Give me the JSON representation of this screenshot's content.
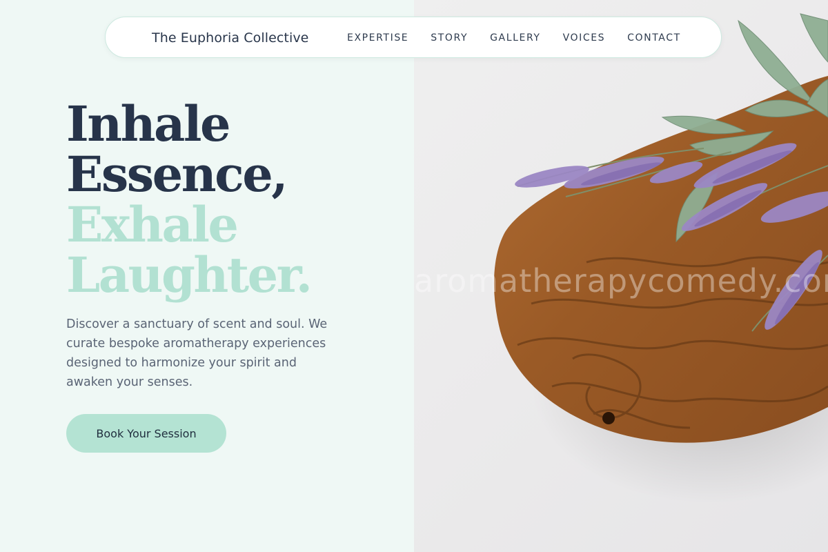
{
  "nav": {
    "brand": "The Euphoria Collective",
    "links": [
      "EXPERTISE",
      "STORY",
      "GALLERY",
      "VOICES",
      "CONTACT"
    ]
  },
  "hero": {
    "headline_line1": "Inhale",
    "headline_line2": "Essence,",
    "headline_line3": "Exhale",
    "headline_line4": "Laughter.",
    "description": "Discover a sanctuary of scent and soul. We curate bespoke aromatherapy experiences designed to harmonize your spirit and awaken your senses.",
    "cta_label": "Book Your Session"
  },
  "image": {
    "watermark": "aromatherapycomedy.com"
  },
  "colors": {
    "dark_text": "#27344a",
    "mint_accent": "#b2e1d2",
    "left_panel_bg": "#eff8f5",
    "button_bg": "#b4e3d3"
  }
}
